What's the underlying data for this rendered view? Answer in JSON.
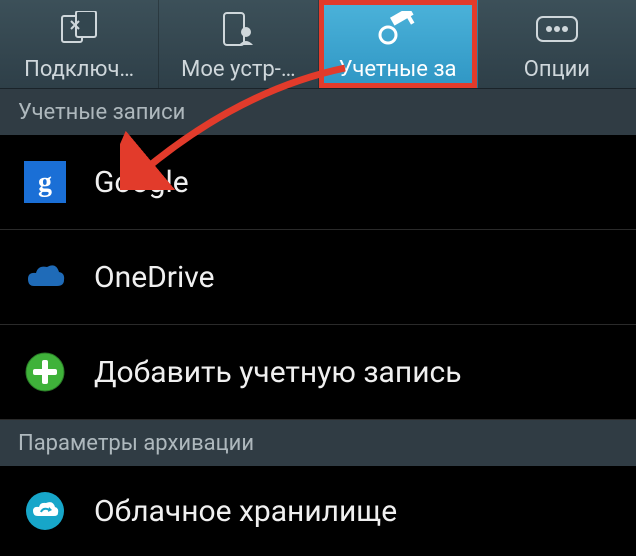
{
  "tabs": [
    {
      "label": "Подключ…"
    },
    {
      "label": "Мое устр-…"
    },
    {
      "label": "Учетные за"
    },
    {
      "label": "Опции"
    }
  ],
  "sections": {
    "accounts_header": "Учетные записи",
    "backup_header": "Параметры архивации"
  },
  "rows": {
    "google": "Google",
    "onedrive": "OneDrive",
    "add_account": "Добавить учетную запись",
    "cloud_storage": "Облачное хранилище"
  }
}
